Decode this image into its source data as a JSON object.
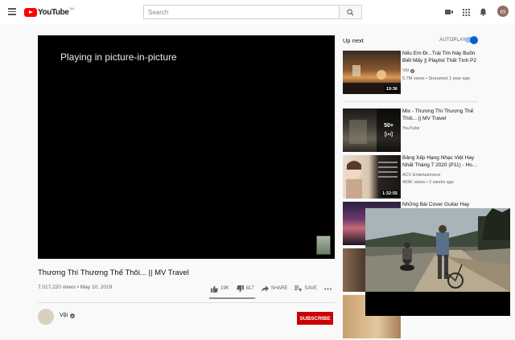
{
  "header": {
    "logo_text": "YouTube",
    "logo_badge": "VN",
    "search_placeholder": "Search",
    "avatar_letter": "m",
    "icons": [
      "menu-icon",
      "search-icon",
      "video-camera-icon",
      "apps-grid-icon",
      "bell-icon"
    ]
  },
  "player": {
    "pip_message": "Playing in picture-in-picture"
  },
  "video": {
    "title": "Thương Thì Thương Thế Thôi... || MV Travel",
    "meta": "7,017,220 views • May 10, 2019",
    "likes": "19K",
    "dislikes": "817",
    "like_ratio": 0.96,
    "share_label": "SHARE",
    "save_label": "SAVE",
    "channel_name": "Vội",
    "subscribe_label": "SUBSCRIBE"
  },
  "sidebar": {
    "up_next_label": "Up next",
    "autoplay_label": "AUTOPLAY",
    "autoplay_on": true,
    "items": [
      {
        "title": "Nếu Em Đi...Trái Tim Này Buồn Biết Mấy || Playlist Thất Tình P2",
        "channel": "Vội",
        "verified": true,
        "stats": "5.7M views • Streamed 1 year ago",
        "duration": "19:36"
      },
      {
        "title": "Mix - Thương Thì Thương Thế Thôi... || MV Travel",
        "channel": "YouTube",
        "verified": false,
        "stats": "",
        "mix_count": "50+"
      },
      {
        "title": "Bảng Xếp Hạng Nhạc Việt Hay Nhất Tháng 7 2020 (P11) - Ho...",
        "channel": "ACV Entertainment",
        "verified": false,
        "stats": "459K views • 2 weeks ago",
        "duration": "1:32:55"
      },
      {
        "title": "Những Bài Cover Guitar Hay",
        "channel": "",
        "verified": false,
        "stats": ""
      }
    ]
  },
  "colors": {
    "brand_red": "#ff0000",
    "subscribe_red": "#cc0000",
    "toggle_blue": "#065fd4",
    "page_bg": "#f9f9f9"
  }
}
